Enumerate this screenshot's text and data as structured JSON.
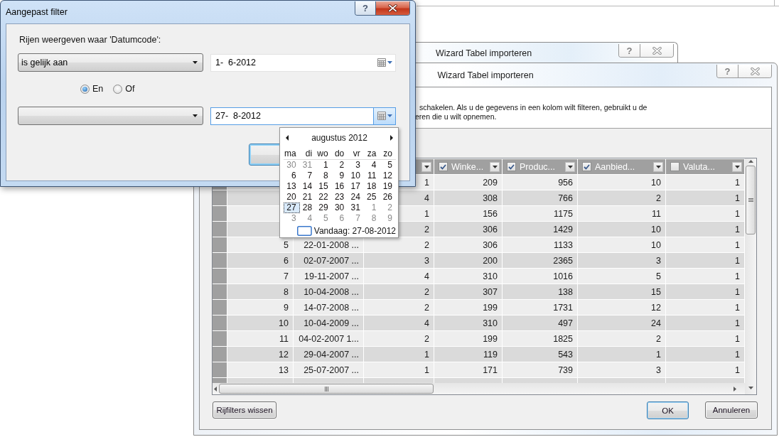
{
  "background_window": {
    "title": "Wizard Tabel importeren",
    "help_button": "?"
  },
  "wizard": {
    "title": "Wizard Tabel importeren",
    "help_button": "?",
    "description_lines": [
      "schakelen. Als u de gegevens in een kolom wilt filteren, gebruikt u de",
      "eren die u wilt opnemen."
    ],
    "table": {
      "columns": [
        {
          "label": "Winke...",
          "checked": true
        },
        {
          "label": "Produc...",
          "checked": true
        },
        {
          "label": "Aanbied...",
          "checked": true
        },
        {
          "label": "Valuta...",
          "checked": false
        }
      ],
      "rows": [
        {
          "values": [
            "1",
            "209",
            "956",
            "10",
            "1"
          ]
        },
        {
          "values": [
            "4",
            "308",
            "766",
            "2",
            "1"
          ]
        },
        {
          "values": [
            "1",
            "156",
            "1175",
            "11",
            "1"
          ]
        },
        {
          "values": [
            "2",
            "306",
            "1429",
            "10",
            "1"
          ]
        },
        {
          "index": "5",
          "date": "22-01-2008 ...",
          "values": [
            "2",
            "306",
            "1133",
            "10",
            "1"
          ]
        },
        {
          "index": "6",
          "date": "02-07-2007 ...",
          "values": [
            "3",
            "200",
            "2365",
            "3",
            "1"
          ]
        },
        {
          "index": "7",
          "date": "19-11-2007 ...",
          "values": [
            "4",
            "310",
            "1016",
            "5",
            "1"
          ]
        },
        {
          "index": "8",
          "date": "10-04-2008 ...",
          "values": [
            "2",
            "307",
            "138",
            "15",
            "1"
          ]
        },
        {
          "index": "9",
          "date": "14-07-2008 ...",
          "values": [
            "2",
            "199",
            "1731",
            "12",
            "1"
          ]
        },
        {
          "index": "10",
          "date": "10-04-2009 ...",
          "values": [
            "4",
            "310",
            "497",
            "24",
            "1"
          ]
        },
        {
          "index": "11",
          "date": "04-02-2007 1...",
          "values": [
            "2",
            "199",
            "1825",
            "2",
            "1"
          ]
        },
        {
          "index": "12",
          "date": "29-04-2007 ...",
          "values": [
            "1",
            "119",
            "543",
            "1",
            "1"
          ]
        },
        {
          "index": "13",
          "date": "25-07-2007 ...",
          "values": [
            "1",
            "171",
            "739",
            "3",
            "1"
          ]
        }
      ]
    },
    "buttons": [
      {
        "label": "Rijfilters wissen",
        "default": false
      },
      {
        "label": "OK",
        "default": true
      },
      {
        "label": "Annuleren",
        "default": false
      }
    ]
  },
  "filter_dialog": {
    "title": "Aangepast filter",
    "help_button": "?",
    "prompt": "Rijen weergeven waar 'Datumcode':",
    "conditions": [
      {
        "operator": "is gelijk aan",
        "value": "1-  6-2012",
        "dropdown_open": false
      },
      {
        "value": "27-  8-2012",
        "dropdown_open": true
      }
    ],
    "logic": [
      {
        "label": "En",
        "selected": true
      },
      {
        "label": "Of",
        "selected": false
      }
    ]
  },
  "calendar": {
    "month": "augustus 2012",
    "weekdays": [
      "ma",
      "di",
      "wo",
      "do",
      "vr",
      "za",
      "zo"
    ],
    "weeks": [
      [
        {
          "day": "30",
          "other_month": true,
          "selected": false
        },
        {
          "day": "31",
          "other_month": true,
          "selected": false
        },
        {
          "day": "1",
          "other_month": false,
          "selected": false
        },
        {
          "day": "2",
          "other_month": false,
          "selected": false
        },
        {
          "day": "3",
          "other_month": false,
          "selected": false
        },
        {
          "day": "4",
          "other_month": false,
          "selected": false
        },
        {
          "day": "5",
          "other_month": false,
          "selected": false
        }
      ],
      [
        {
          "day": "6",
          "other_month": false,
          "selected": false
        },
        {
          "day": "7",
          "other_month": false,
          "selected": false
        },
        {
          "day": "8",
          "other_month": false,
          "selected": false
        },
        {
          "day": "9",
          "other_month": false,
          "selected": false
        },
        {
          "day": "10",
          "other_month": false,
          "selected": false
        },
        {
          "day": "11",
          "other_month": false,
          "selected": false
        },
        {
          "day": "12",
          "other_month": false,
          "selected": false
        }
      ],
      [
        {
          "day": "13",
          "other_month": false,
          "selected": false
        },
        {
          "day": "14",
          "other_month": false,
          "selected": false
        },
        {
          "day": "15",
          "other_month": false,
          "selected": false
        },
        {
          "day": "16",
          "other_month": false,
          "selected": false
        },
        {
          "day": "17",
          "other_month": false,
          "selected": false
        },
        {
          "day": "18",
          "other_month": false,
          "selected": false
        },
        {
          "day": "19",
          "other_month": false,
          "selected": false
        }
      ],
      [
        {
          "day": "20",
          "other_month": false,
          "selected": false
        },
        {
          "day": "21",
          "other_month": false,
          "selected": false
        },
        {
          "day": "22",
          "other_month": false,
          "selected": false
        },
        {
          "day": "23",
          "other_month": false,
          "selected": false
        },
        {
          "day": "24",
          "other_month": false,
          "selected": false
        },
        {
          "day": "25",
          "other_month": false,
          "selected": false
        },
        {
          "day": "26",
          "other_month": false,
          "selected": false
        }
      ],
      [
        {
          "day": "27",
          "other_month": false,
          "selected": true
        },
        {
          "day": "28",
          "other_month": false,
          "selected": false
        },
        {
          "day": "29",
          "other_month": false,
          "selected": false
        },
        {
          "day": "30",
          "other_month": false,
          "selected": false
        },
        {
          "day": "31",
          "other_month": false,
          "selected": false
        },
        {
          "day": "1",
          "other_month": true,
          "selected": false
        },
        {
          "day": "2",
          "other_month": true,
          "selected": false
        }
      ],
      [
        {
          "day": "3",
          "other_month": true,
          "selected": false
        },
        {
          "day": "4",
          "other_month": true,
          "selected": false
        },
        {
          "day": "5",
          "other_month": true,
          "selected": false
        },
        {
          "day": "6",
          "other_month": true,
          "selected": false
        },
        {
          "day": "7",
          "other_month": true,
          "selected": false
        },
        {
          "day": "8",
          "other_month": true,
          "selected": false
        },
        {
          "day": "9",
          "other_month": true,
          "selected": false
        }
      ]
    ],
    "today": "Vandaag: 27-08-2012"
  }
}
